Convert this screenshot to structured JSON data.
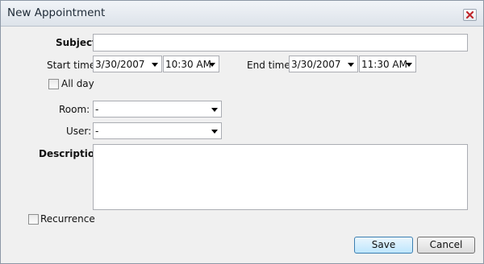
{
  "window": {
    "title": "New Appointment"
  },
  "form": {
    "subject": {
      "label": "Subject",
      "value": ""
    },
    "start": {
      "label": "Start time",
      "date": "3/30/2007",
      "time": "10:30 AM"
    },
    "end": {
      "label": "End time",
      "date": "3/30/2007",
      "time": "11:30 AM"
    },
    "all_day": {
      "label": "All day",
      "checked": false
    },
    "room": {
      "label": "Room:",
      "value": "-"
    },
    "user": {
      "label": "User:",
      "value": "-"
    },
    "description": {
      "label": "Description",
      "value": ""
    },
    "recurrence": {
      "label": "Recurrence",
      "checked": false
    }
  },
  "buttons": {
    "save": "Save",
    "cancel": "Cancel"
  },
  "icons": {
    "close": "close-icon",
    "dropdown": "chevron-down-icon"
  },
  "colors": {
    "close_x": "#c0282d",
    "default_button_border": "#3c7fb1"
  }
}
